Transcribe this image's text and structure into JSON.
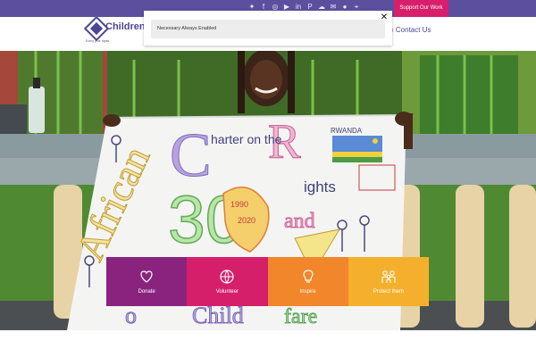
{
  "topbar": {
    "social_icons": [
      "twitter-icon",
      "facebook-icon",
      "instagram-icon",
      "youtube-icon",
      "linkedin-icon",
      "pinterest-icon",
      "soundcloud-icon",
      "email-icon",
      "flickr-icon",
      "location-icon"
    ],
    "support_label": "Support Our Work",
    "colors": {
      "bar": "#5b4f9e",
      "support": "#d81f6b"
    }
  },
  "header": {
    "logo_name": "Children",
    "logo_tagline": "Every year rights",
    "nav_contact": "Contact Us"
  },
  "cookie": {
    "text": "Necessary Always Enabled",
    "close_label": "✕"
  },
  "hero": {
    "poster_title_line1": "African",
    "poster_title_line2": "Charter on the",
    "poster_rights": "Rights",
    "poster_country": "RWANDA",
    "poster_years": "1990 2020",
    "poster_number": "30",
    "poster_and": "and",
    "poster_child": "Child",
    "poster_welfare": "fare"
  },
  "tiles": [
    {
      "label": "Donate",
      "icon": "heart-hand-icon",
      "color": "#8a237e"
    },
    {
      "label": "Volunteer",
      "icon": "globe-icon",
      "color": "#d51f6b"
    },
    {
      "label": "Inspire",
      "icon": "lightbulb-icon",
      "color": "#f1862a"
    },
    {
      "label": "Protect them",
      "icon": "family-icon",
      "color": "#f4b02c"
    }
  ]
}
